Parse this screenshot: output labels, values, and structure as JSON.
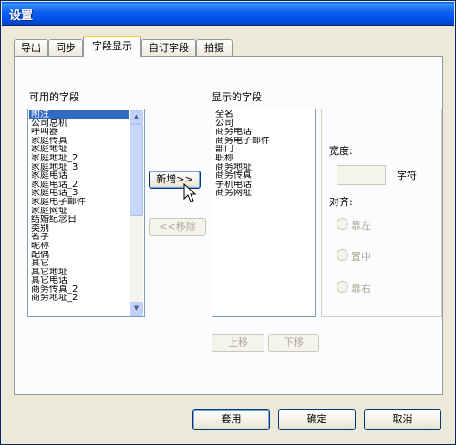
{
  "window": {
    "title": "设置"
  },
  "tabs": [
    {
      "label": "导出",
      "active": false
    },
    {
      "label": "同步",
      "active": false
    },
    {
      "label": "字段显示",
      "active": true
    },
    {
      "label": "自订字段",
      "active": false
    },
    {
      "label": "拍摄",
      "active": false
    }
  ],
  "available_fields": {
    "label": "可用的字段",
    "items": [
      "附注",
      "公司总机",
      "呼叫器",
      "家庭传真",
      "家庭地址",
      "家庭地址_2",
      "家庭地址_3",
      "家庭电话",
      "家庭电话_2",
      "家庭电话_3",
      "家庭电子邮件",
      "家庭网址",
      "结婚纪念日",
      "类别",
      "名字",
      "昵称",
      "配偶",
      "其它",
      "其它地址",
      "其它电话",
      "商务传真_2",
      "商务地址_2"
    ],
    "selected_index": 0
  },
  "displayed_fields": {
    "label": "显示的字段",
    "items": [
      "全名",
      "公司",
      "商务电话",
      "商务电子邮件",
      "部门",
      "职称",
      "商务地址",
      "商务传真",
      "手机电话",
      "商务网址"
    ]
  },
  "buttons": {
    "add": "新增>>",
    "remove": "<<移除",
    "move_up": "上移",
    "move_down": "下移",
    "apply": "套用",
    "ok": "确定",
    "cancel": "取消"
  },
  "options": {
    "width_label": "宽度:",
    "width_value": "",
    "width_unit": "字符",
    "align_label": "对齐:",
    "align_left": "靠左",
    "align_center": "置中",
    "align_right": "靠右"
  },
  "colors": {
    "titlebar": "#0a5ef0",
    "selection": "#316ac5",
    "active_tab_accent": "#ffc83c"
  }
}
